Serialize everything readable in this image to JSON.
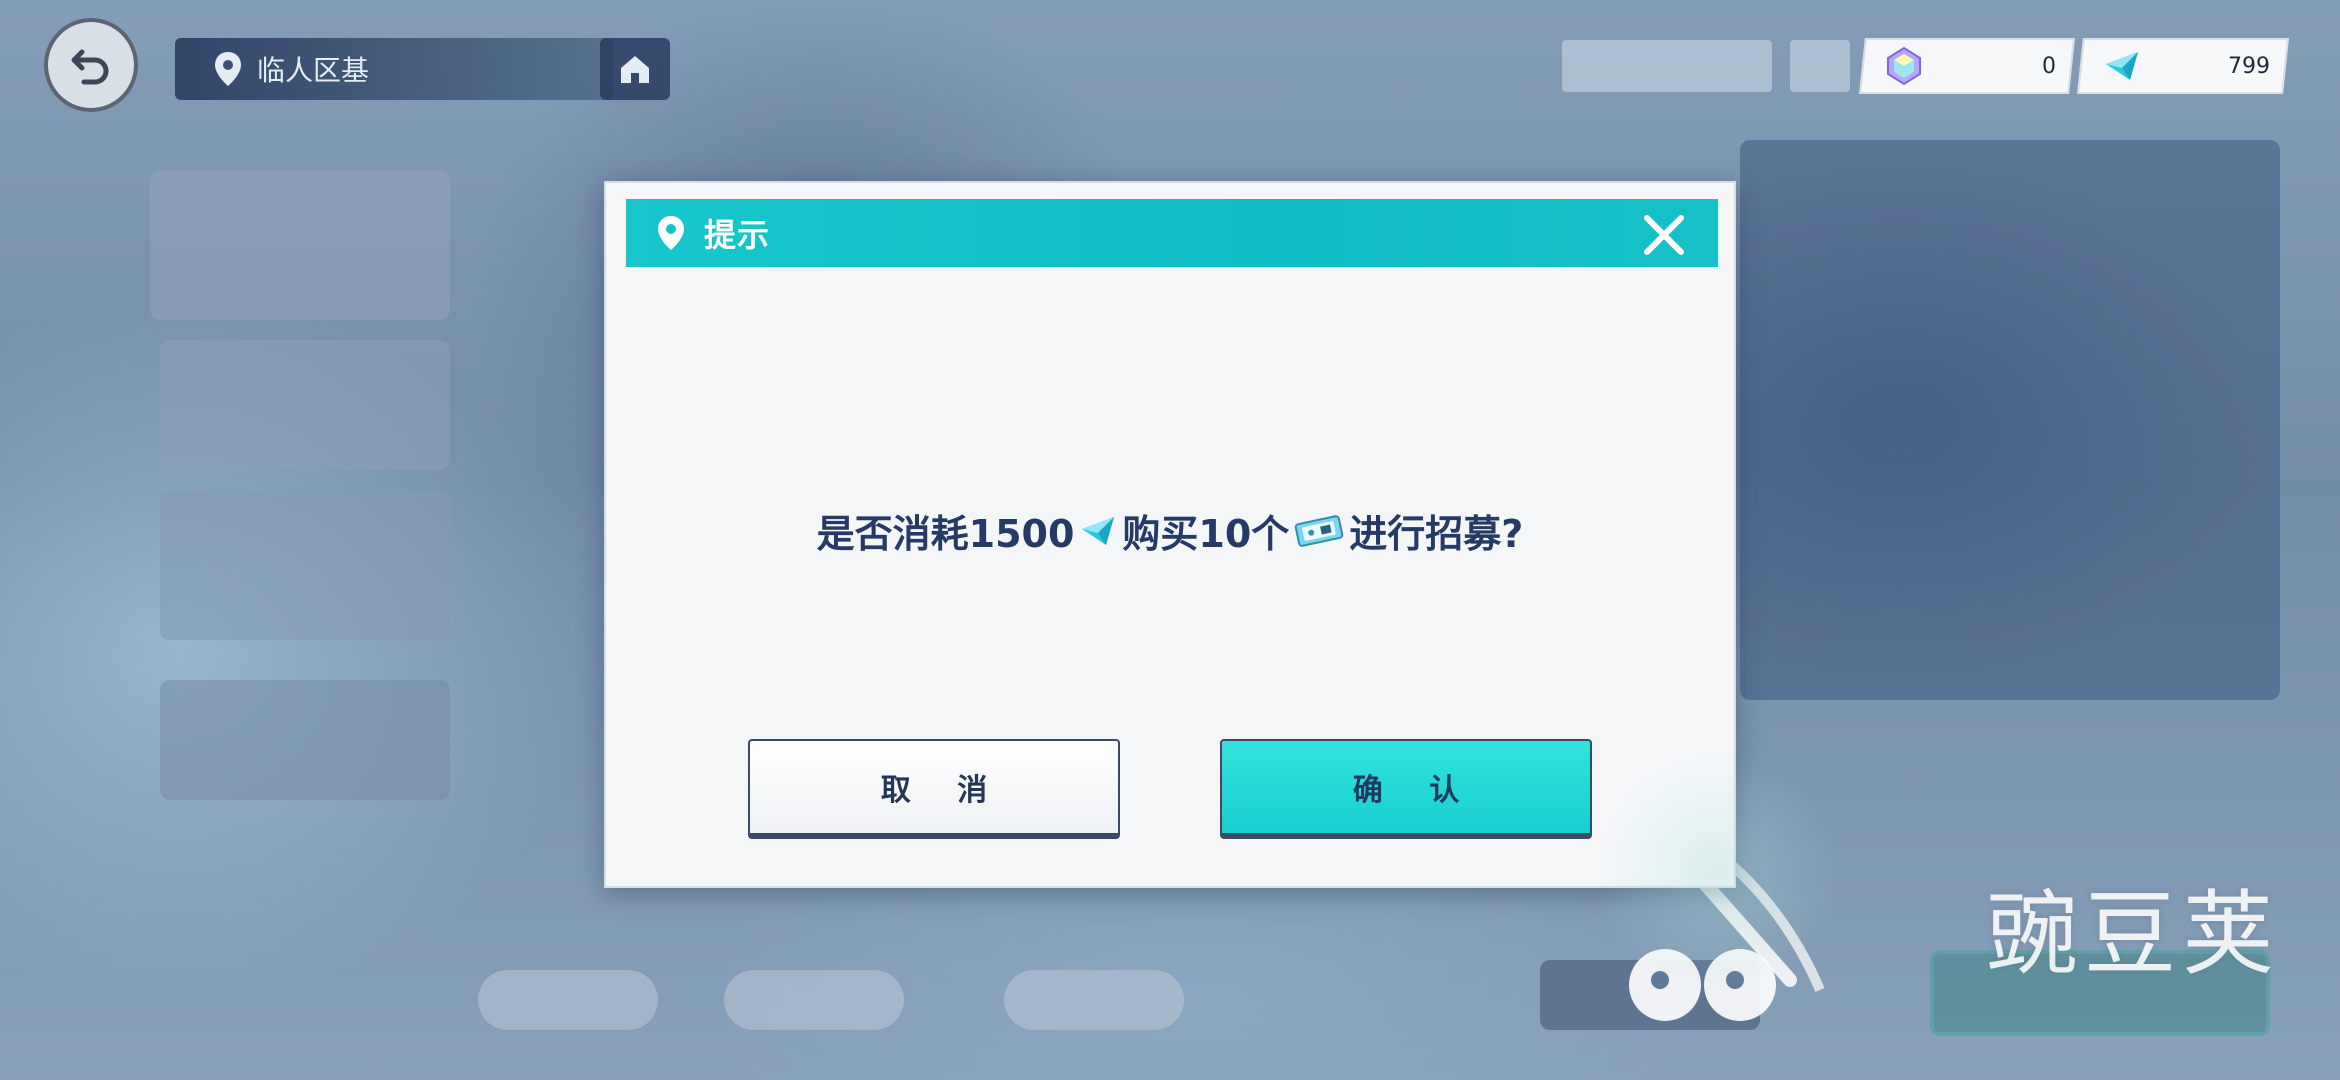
{
  "nav": {
    "location": "临人区基"
  },
  "currency": [
    {
      "icon": "crystal-gem-icon",
      "value": "0"
    },
    {
      "icon": "blue-diamond-icon",
      "value": "799"
    }
  ],
  "dialog": {
    "title": "提示",
    "message_pre": "是否消耗1500",
    "message_mid": "购买10个",
    "message_post": "进行招募?",
    "cancel_label": "取 消",
    "confirm_label": "确 认"
  },
  "watermark": "豌豆荚",
  "colors": {
    "header_teal": "#13c3c9",
    "confirm_teal": "#22d8d6",
    "message_navy": "#263a66"
  }
}
